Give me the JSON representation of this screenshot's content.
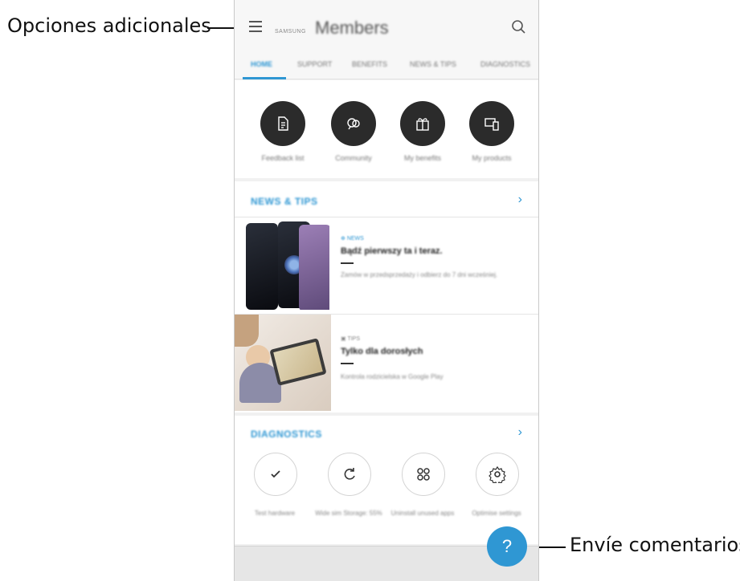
{
  "callouts": {
    "more_options": "Opciones adicionales",
    "send_feedback": "Envíe comentarios"
  },
  "appbar": {
    "brand": "SAMSUNG",
    "title": "Members",
    "menu_icon": "menu-icon",
    "search_icon": "search-icon"
  },
  "tabs": [
    "HOME",
    "SUPPORT",
    "BENEFITS",
    "NEWS & TIPS",
    "DIAGNOSTICS"
  ],
  "quick_actions": [
    {
      "label": "Feedback list",
      "icon": "document-icon"
    },
    {
      "label": "Community",
      "icon": "community-icon"
    },
    {
      "label": "My benefits",
      "icon": "gift-icon"
    },
    {
      "label": "My products",
      "icon": "devices-icon"
    }
  ],
  "news": {
    "title": "NEWS & TIPS",
    "items": [
      {
        "meta": "NEWS",
        "headline": "Bądź pierwszy ta i teraz.",
        "description": "Zamów w przedsprzedaży i odbierz do 7 dni wcześniej."
      },
      {
        "meta": "TIPS",
        "headline": "Tylko dla dorosłych",
        "description": "Kontrola rodzicielska w Google Play"
      }
    ]
  },
  "diagnostics": {
    "title": "DIAGNOSTICS",
    "items": [
      {
        "label": "Test hardware",
        "icon": "check-icon"
      },
      {
        "label": "Wide sim Storage: 55%",
        "icon": "refresh-icon"
      },
      {
        "label": "Uninstall unused apps",
        "icon": "apps-icon"
      },
      {
        "label": "Optimise settings",
        "icon": "settings-icon"
      }
    ]
  },
  "fab": {
    "label": "?",
    "icon": "help-icon"
  },
  "colors": {
    "accent": "#2f97d3",
    "dark_button": "#2b2b2b",
    "background": "#f1f1f1"
  }
}
